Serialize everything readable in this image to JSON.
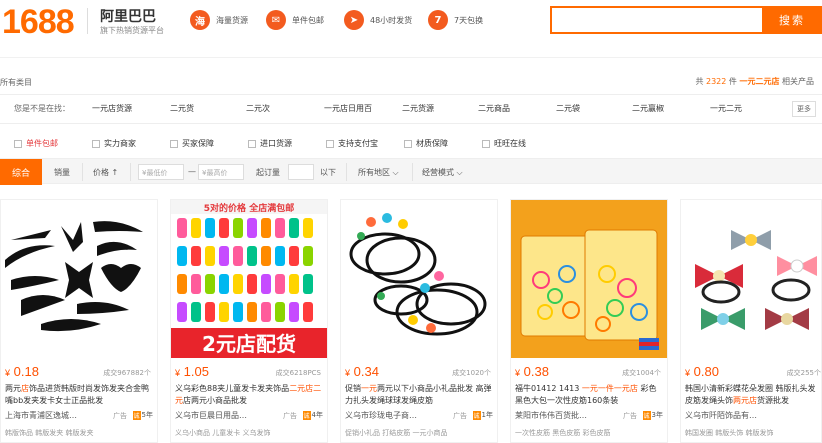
{
  "header": {
    "logo": "1688",
    "brand": "阿里巴巴",
    "brand_sub": "旗下热销货源平台",
    "features": [
      {
        "icon": "sea-icon",
        "glyph": "海",
        "label": "海量货源"
      },
      {
        "icon": "package-icon",
        "glyph": "✉",
        "label": "单件包邮"
      },
      {
        "icon": "rocket-icon",
        "glyph": "➤",
        "label": "48小时发货"
      },
      {
        "icon": "seven-day-icon",
        "glyph": "7",
        "label": "7天包换"
      }
    ],
    "search_value": "",
    "search_button": "搜索"
  },
  "breadcrumb": "所有类目",
  "result_count": {
    "prefix": "共",
    "num": "2322",
    "unit": "件",
    "keyword": "一元二元店",
    "suffix": "相关产品"
  },
  "keywords": {
    "label": "您是不是在找：",
    "items": [
      "一元店货源",
      "二元货",
      "二元次",
      "一元店日用百",
      "二元货源",
      "二元商品",
      "二元袋",
      "二元赢椒",
      "一元二元"
    ],
    "more": "更多"
  },
  "filters": [
    "单件包邮",
    "实力商家",
    "买家保障",
    "进口货源",
    "支持支付宝",
    "材质保障",
    "旺旺在线"
  ],
  "sort": {
    "active": "综合",
    "sales": "销量",
    "price": "价格 ↑",
    "min_price": "¥最低价",
    "dash": "—",
    "max_price": "¥最高价",
    "moq": "起订量",
    "moq_suffix": "以下",
    "region": "所有地区",
    "mode": "经营模式"
  },
  "colors": {
    "accent": "#ff6a00",
    "price": "#ff5000"
  },
  "products": [
    {
      "price": "0.18",
      "sales": "成交967882个",
      "title_pre": "两元",
      "title_em": "店",
      "title_post": "饰品进货韩版时尚发饰发夹合金鸭嘴bb发夹发卡女士正品批发",
      "seller": "上海市青浦区逸城…",
      "ad": "广告",
      "years": "5年",
      "tags": "韩版饰品 韩版发夹 韩版发夹"
    },
    {
      "price": "1.05",
      "sales": "成交6218PCS",
      "title_pre": "义乌彩色88夹儿童发卡发夹饰品",
      "title_em": "二元店二元",
      "title_post": "店两元小商品批发",
      "seller": "义乌市巨晨日用品…",
      "ad": "广告",
      "years": "4年",
      "tags": "义乌小商品 儿童发卡 义乌发饰"
    },
    {
      "price": "0.34",
      "sales": "成交1020个",
      "title_pre": "促销",
      "title_em": "一元",
      "title_post": "两元以下小商品小礼品批发 高弹力扎头发绳球球发绳皮筋",
      "seller": "义乌市珍珑电子商…",
      "ad": "广告",
      "years": "1年",
      "tags": "促销小礼品 打结皮筋 一元小商品"
    },
    {
      "price": "0.38",
      "sales": "成交1004个",
      "title_pre": "福牛01412 1413 ",
      "title_em": "一元一件一元店",
      "title_post": " 彩色黑色大包一次性皮筋160条装",
      "seller": "莱阳市伟伟百货批…",
      "ad": "广告",
      "years": "3年",
      "tags": "一次性皮筋 黑色皮筋 彩色皮筋"
    },
    {
      "price": "0.80",
      "sales": "成交255个",
      "title_pre": "韩国小清新彩蝶花朵发圈 韩版扎头发皮筋发绳头饰",
      "title_em": "两元店",
      "title_post": "货源批发",
      "seller": "义乌市阡陌饰品有…",
      "ad": "",
      "years": "",
      "tags": "韩国发圈 韩版头饰 韩版发饰"
    }
  ],
  "card2_banner": "5对的价格 全店满包邮",
  "card2_footer": "2元店配货"
}
